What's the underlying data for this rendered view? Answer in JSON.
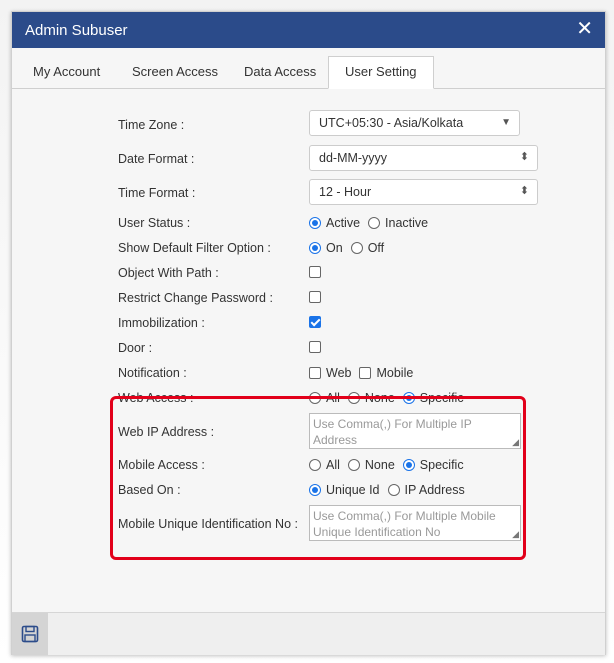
{
  "dialog": {
    "title": "Admin Subuser",
    "close_glyph": "✕"
  },
  "tabs": [
    {
      "label": "My Account",
      "active": false
    },
    {
      "label": "Screen Access",
      "active": false
    },
    {
      "label": "Data Access",
      "active": false
    },
    {
      "label": "User Setting",
      "active": true
    }
  ],
  "settings": {
    "time_zone": {
      "label": "Time Zone :",
      "value": "UTC+05:30 - Asia/Kolkata"
    },
    "date_format": {
      "label": "Date Format :",
      "value": "dd-MM-yyyy"
    },
    "time_format": {
      "label": "Time Format :",
      "value": "12 - Hour"
    },
    "user_status": {
      "label": "User Status :",
      "options": [
        "Active",
        "Inactive"
      ],
      "selected": "Active"
    },
    "show_default_filter": {
      "label": "Show Default Filter Option :",
      "options": [
        "On",
        "Off"
      ],
      "selected": "On"
    },
    "object_with_path": {
      "label": "Object With Path :",
      "checked": false
    },
    "restrict_change_password": {
      "label": "Restrict Change Password :",
      "checked": false
    },
    "immobilization": {
      "label": "Immobilization :",
      "checked": true
    },
    "door": {
      "label": "Door :",
      "checked": false
    },
    "notification": {
      "label": "Notification :",
      "options": [
        "Web",
        "Mobile"
      ],
      "checked": [
        false,
        false
      ]
    },
    "web_access": {
      "label": "Web Access :",
      "options": [
        "All",
        "None",
        "Specific"
      ],
      "selected": "Specific"
    },
    "web_ip_address": {
      "label": "Web IP Address :",
      "placeholder": "Use Comma(,) For Multiple IP Address"
    },
    "mobile_access": {
      "label": "Mobile Access :",
      "options": [
        "All",
        "None",
        "Specific"
      ],
      "selected": "Specific"
    },
    "based_on": {
      "label": "Based On :",
      "options": [
        "Unique Id",
        "IP Address"
      ],
      "selected": "Unique Id"
    },
    "mobile_unique_id": {
      "label": "Mobile Unique Identification No :",
      "placeholder": "Use Comma(,) For Multiple Mobile Unique Identification No"
    }
  },
  "colors": {
    "titlebar": "#2b4b8a",
    "highlight": "#e2001a",
    "accent": "#1a73e8"
  },
  "footer": {
    "save_icon": "save-icon"
  }
}
